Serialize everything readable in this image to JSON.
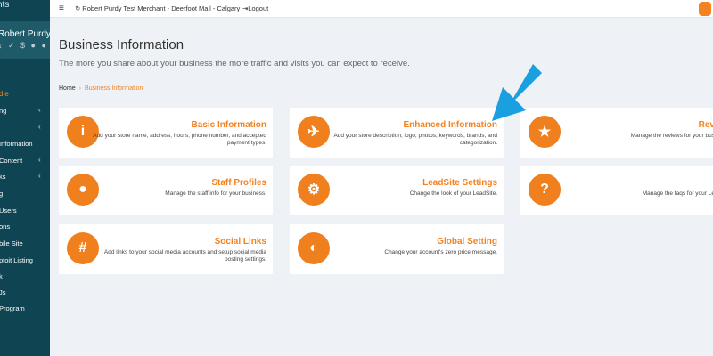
{
  "sidebar": {
    "brand": "nts",
    "user_name": "Robert Purdy",
    "user_icons": "↓ ✓ $ ● ●",
    "active_item": "dle",
    "items": [
      {
        "label": "ng",
        "chevron": true
      },
      {
        "label": "",
        "chevron": true
      },
      {
        "label": "Information",
        "chevron": false
      },
      {
        "label": "Content",
        "chevron": true
      },
      {
        "label": "ks",
        "chevron": true
      },
      {
        "label": "g",
        "chevron": false
      },
      {
        "label": "Users",
        "chevron": false
      },
      {
        "label": "ons",
        "chevron": false
      },
      {
        "label": "bile Site",
        "chevron": false
      },
      {
        "label": "ptoit Listing",
        "chevron": false
      },
      {
        "label": "k",
        "chevron": false
      },
      {
        "label": "Js",
        "chevron": false
      },
      {
        "label": "Program",
        "chevron": false
      }
    ]
  },
  "topbar": {
    "merchant": "Robert Purdy Test Merchant - Deerfoot Mall - Calgary",
    "logout": "Logout"
  },
  "header": {
    "title": "Business Information",
    "subtitle": "The more you share about your business the more traffic and visits you can expect to receive."
  },
  "breadcrumb": {
    "home": "Home",
    "current": "Business Information"
  },
  "cards": [
    {
      "title": "Basic Information",
      "desc": "Add your store name, address, hours, phone number, and accepted payment types.",
      "icon": "i",
      "icon_name": "info-icon"
    },
    {
      "title": "Enhanced Information",
      "desc": "Add your store description, logo, photos, keywords, brands, and categorization.",
      "icon": "✈",
      "icon_name": "rocket-icon"
    },
    {
      "title": "Rev",
      "desc": "Manage the reviews for your bus",
      "icon": "★",
      "icon_name": "star-icon"
    },
    {
      "title": "Staff Profiles",
      "desc": "Manage the staff info for your business.",
      "icon": "●",
      "icon_name": "user-icon"
    },
    {
      "title": "LeadSite Settings",
      "desc": "Change the look of your LeadSite.",
      "icon": "⚙",
      "icon_name": "gear-icon"
    },
    {
      "title": "",
      "desc": "Manage the faqs for your Le",
      "icon": "?",
      "icon_name": "question-icon"
    },
    {
      "title": "Social Links",
      "desc": "Add links to your social media accounts and setup social media posting settings.",
      "icon": "#",
      "icon_name": "hashtag-icon"
    },
    {
      "title": "Global Setting",
      "desc": "Change your account's zero price message.",
      "icon": "◐",
      "icon_name": "globe-icon"
    }
  ],
  "colors": {
    "sidebar_bg": "#0f4452",
    "accent": "#f58220",
    "arrow": "#1a9fe0"
  }
}
